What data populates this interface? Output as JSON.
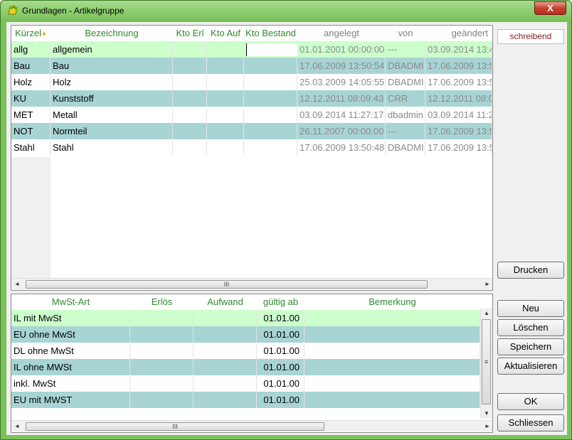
{
  "window": {
    "title": "Grundlagen - Artikelgruppe",
    "close": "X"
  },
  "status": "schreibend",
  "top_grid": {
    "columns": [
      "Kürzel",
      "Bezeichnung",
      "Kto Erl",
      "Kto Auf",
      "Kto Bestand",
      "angelegt",
      "von",
      "geändert"
    ],
    "rows": [
      {
        "kuerzel": "allg",
        "bez": "allgemein",
        "erl": "",
        "auf": "",
        "bestand": "",
        "angelegt": "01.01.2001 00:00:00",
        "von": "---",
        "geaendert": "03.09.2014 13:4"
      },
      {
        "kuerzel": "Bau",
        "bez": "Bau",
        "erl": "",
        "auf": "",
        "bestand": "",
        "angelegt": "17.06.2009 13:50:54",
        "von": "DBADMI",
        "geaendert": "17.06.2009 13:5"
      },
      {
        "kuerzel": "Holz",
        "bez": "Holz",
        "erl": "",
        "auf": "",
        "bestand": "",
        "angelegt": "25.03.2009 14:05:55",
        "von": "DBADMI",
        "geaendert": "17.06.2009 13:5"
      },
      {
        "kuerzel": "KU",
        "bez": "Kunststoff",
        "erl": "",
        "auf": "",
        "bestand": "",
        "angelegt": "12.12.2011 08:09:43",
        "von": "CRR",
        "geaendert": "12.12.2011 08:0"
      },
      {
        "kuerzel": "MET",
        "bez": "Metall",
        "erl": "",
        "auf": "",
        "bestand": "",
        "angelegt": "03.09.2014 11:27:17",
        "von": "dbadmin",
        "geaendert": "03.09.2014 11:2"
      },
      {
        "kuerzel": "NOT",
        "bez": "Normteil",
        "erl": "",
        "auf": "",
        "bestand": "",
        "angelegt": "26.11.2007 00:00:00",
        "von": "---",
        "geaendert": "17.06.2009 13:5"
      },
      {
        "kuerzel": "Stahl",
        "bez": "Stahl",
        "erl": "",
        "auf": "",
        "bestand": "",
        "angelegt": "17.06.2009 13:50:48",
        "von": "DBADMI",
        "geaendert": "17.06.2009 13:5"
      }
    ],
    "scroll_grip": "III"
  },
  "bottom_grid": {
    "columns": [
      "MwSt-Art",
      "Erlös",
      "Aufwand",
      "gültig ab",
      "Bemerkung"
    ],
    "rows": [
      {
        "art": "IL mit MwSt",
        "erloes": "",
        "aufwand": "",
        "gueltig": "01.01.00",
        "bem": ""
      },
      {
        "art": "EU ohne MwSt",
        "erloes": "",
        "aufwand": "",
        "gueltig": "01.01.00",
        "bem": ""
      },
      {
        "art": "DL ohne MwSt",
        "erloes": "",
        "aufwand": "",
        "gueltig": "01.01.00",
        "bem": ""
      },
      {
        "art": "IL ohne MWSt",
        "erloes": "",
        "aufwand": "",
        "gueltig": "01.01.00",
        "bem": ""
      },
      {
        "art": "inkl. MwSt",
        "erloes": "",
        "aufwand": "",
        "gueltig": "01.01.00",
        "bem": ""
      },
      {
        "art": "EU mit MWST",
        "erloes": "",
        "aufwand": "",
        "gueltig": "01.01.00",
        "bem": ""
      }
    ],
    "scroll_grip": "III",
    "vscroll_grip": "≡"
  },
  "buttons": {
    "drucken": "Drucken",
    "neu": "Neu",
    "loeschen": "Löschen",
    "speichern": "Speichern",
    "aktualisieren": "Aktualisieren",
    "ok": "OK",
    "schliessen": "Schliessen"
  },
  "colors": {
    "row_selected": "#ccffcc",
    "row_alt": "#a8d4d4",
    "header_text": "#2f8a2f",
    "window_frame": "#7bc25a"
  }
}
